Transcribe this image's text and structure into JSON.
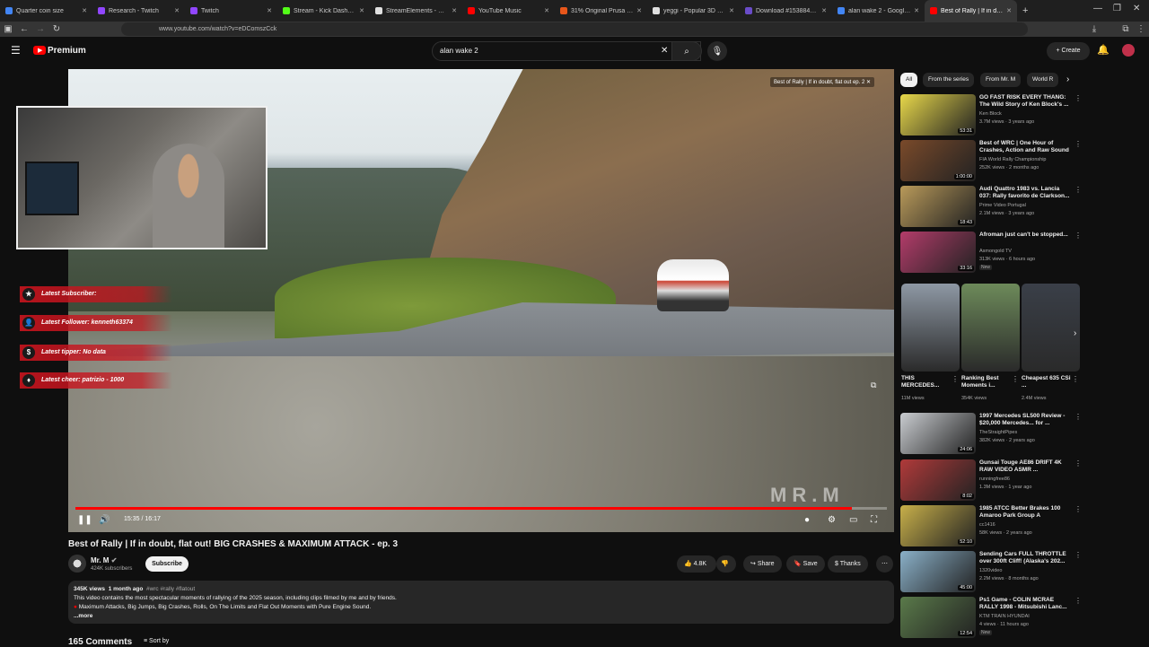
{
  "browser": {
    "tabs": [
      {
        "title": "Quarter coin size",
        "color": "#4285f4"
      },
      {
        "title": "Research - Twitch",
        "color": "#9146ff"
      },
      {
        "title": "Twitch",
        "color": "#9146ff"
      },
      {
        "title": "Stream - Kick Dashboard",
        "color": "#53fc18"
      },
      {
        "title": "StreamElements - Overlays",
        "color": "#e0e0e0"
      },
      {
        "title": "YouTube Music",
        "color": "#ff0000"
      },
      {
        "title": "31% Original Prusa i3 MK3S",
        "color": "#e8561a"
      },
      {
        "title": "yeggi - Popular 3D Models",
        "color": "#e0e0e0"
      },
      {
        "title": "Download #153884539 - C",
        "color": "#6a4cc8"
      },
      {
        "title": "alan wake 2 - Google Search",
        "color": "#4285f4"
      },
      {
        "title": "Best of Rally | If in doubt",
        "color": "#ff0000"
      }
    ],
    "url": "www.youtube.com/watch?v=eDComszCck"
  },
  "header": {
    "logo_text": "Premium",
    "search_value": "alan wake 2",
    "create_label": "Create"
  },
  "player": {
    "overlay_title": "Best of Rally | If in doubt, flat out ep. 2",
    "alerts": [
      {
        "icon": "star-icon",
        "text": "Latest Subscriber:"
      },
      {
        "icon": "person-icon",
        "text": "Latest Follower: kenneth63374"
      },
      {
        "icon": "dollar-icon",
        "text": "Latest tipper: No data"
      },
      {
        "icon": "diamond-icon",
        "text": "Latest cheer: patrizio - 1000"
      }
    ],
    "time": "15:35 / 16:17",
    "progress": 0.957,
    "watermark": "MR.M"
  },
  "video": {
    "title": "Best of Rally | If in doubt, flat out! BIG CRASHES & MAXIMUM ATTACK - ep. 3",
    "channel": "Mr. M",
    "subscribers": "424K subscribers",
    "subscribe_label": "Subscribe",
    "likes": "4.8K",
    "share_label": "Share",
    "save_label": "Save",
    "thanks_label": "Thanks",
    "views": "345K views",
    "age": "1 month ago",
    "tags": "#wrc #rally #flatout",
    "desc_line1": "This video contains the most spectacular moments of rallying of the 2025 season, including clips filmed by me and by friends.",
    "desc_line2": "Maximum Attacks, Big Jumps, Big Crashes, Rolls, On The Limits and Flat Out Moments with Pure Engine Sound.",
    "more_label": "...more",
    "comments_count": "165 Comments",
    "sort_label": "Sort by"
  },
  "sidebar": {
    "chips": [
      "All",
      "From the series",
      "From Mr. M",
      "World R"
    ],
    "recs_top": [
      {
        "title": "GO FAST RISK EVERY THANG: The Wild Story of Ken Block's ...",
        "channel": "Ken Block",
        "meta": "3.7M views · 3 years ago",
        "duration": "53:31",
        "badge": "",
        "color": "#e8d84a"
      },
      {
        "title": "Best of WRC | One Hour of Crashes, Action and Raw Sound",
        "channel": "FIA World Rally Championship",
        "meta": "252K views · 2 months ago",
        "duration": "1:00:00",
        "badge": "",
        "color": "#7a4a2a"
      },
      {
        "title": "Audi Quattro 1983 vs. Lancia 037: Rally favorito de Clarkson...",
        "channel": "Prime Video Portugal",
        "meta": "2.1M views · 3 years ago",
        "duration": "18:43",
        "badge": "",
        "color": "#b99a5a"
      },
      {
        "title": "Afroman just can't be stopped...",
        "channel": "Asmongold TV",
        "meta": "313K views · 6 hours ago",
        "duration": "33:16",
        "badge": "New",
        "color": "#b33c6a"
      }
    ],
    "shorts": [
      {
        "title": "THIS MERCEDES...",
        "views": "11M views",
        "color": "#8e98a4"
      },
      {
        "title": "Ranking Best Moments i...",
        "views": "354K views",
        "color": "#6d8a5a"
      },
      {
        "title": "Cheapest 635 CSi ...",
        "views": "2.4M views",
        "color": "#3a3f48"
      }
    ],
    "recs_bottom": [
      {
        "title": "1997 Mercedes SL500 Review - $20,000 Mercedes... for ...",
        "channel": "TheStraightPipes",
        "meta": "382K views · 2 years ago",
        "duration": "24:06",
        "badge": "",
        "color": "#c9ccd0"
      },
      {
        "title": "Gunsai Touge AE86 DRIFT 4K RAW VIDEO ASMR ...",
        "channel": "runningfree86",
        "meta": "1.3M views · 1 year ago",
        "duration": "8:02",
        "badge": "",
        "color": "#b03a3a"
      },
      {
        "title": "1985 ATCC Better Brakes 100 Amaroo Park Group A",
        "channel": "cc1416",
        "meta": "58K views · 2 years ago",
        "duration": "52:10",
        "badge": "",
        "color": "#c8b04a"
      },
      {
        "title": "Sending Cars FULL THROTTLE over 300ft Cliff! (Alaska's 202...",
        "channel": "1320video",
        "meta": "2.2M views · 8 months ago",
        "duration": "45:00",
        "badge": "",
        "color": "#8ab0c8"
      },
      {
        "title": "Ps1 Game - COLIN MCRAE RALLY 1998 - Mitsubishi Lanc...",
        "channel": "KTM TRAIN HYUNDAI",
        "meta": "4 views · 11 hours ago",
        "duration": "12:54",
        "badge": "New",
        "color": "#5a7a4a"
      }
    ]
  }
}
